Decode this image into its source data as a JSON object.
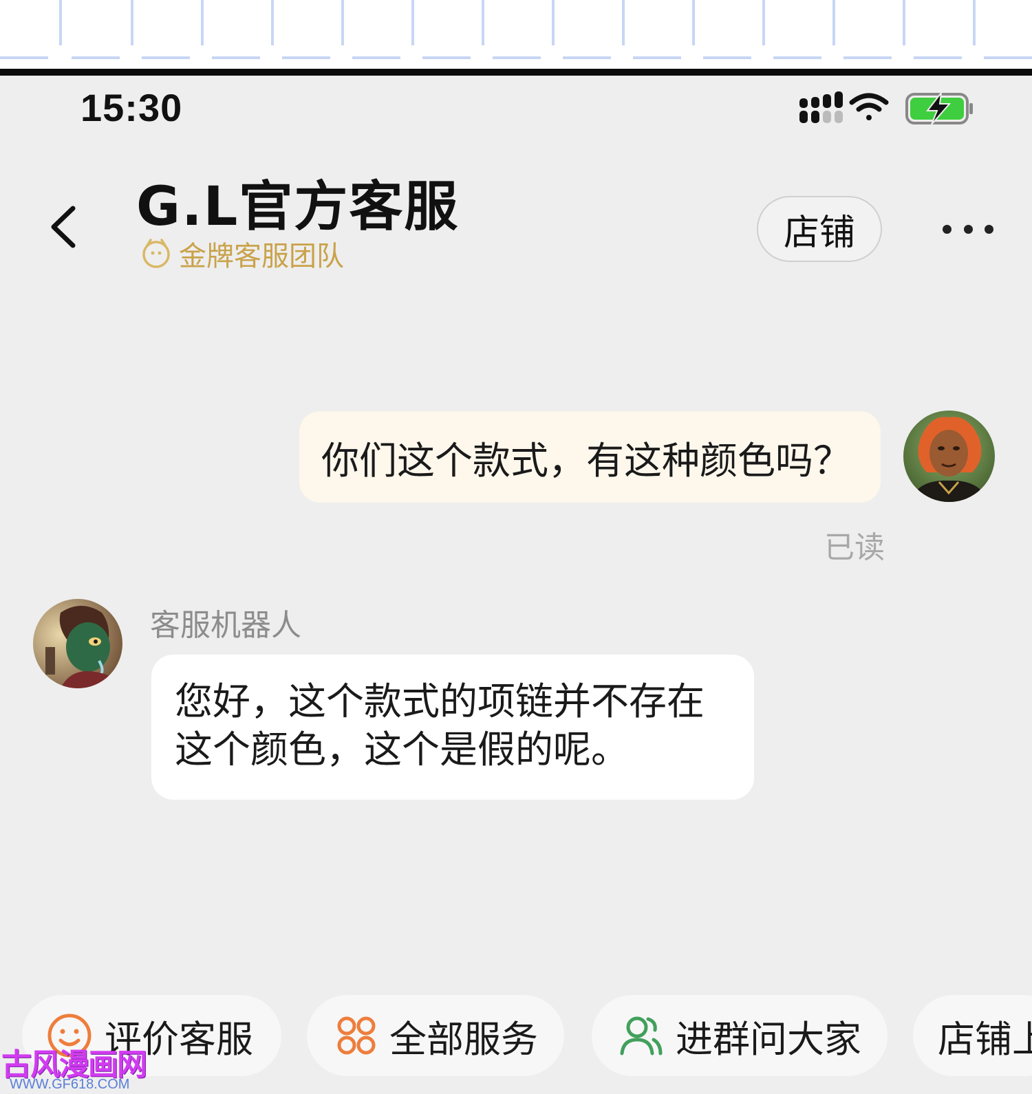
{
  "status_bar": {
    "time": "15:30",
    "icons": [
      "signal-icon",
      "wifi-icon",
      "battery-charging-icon"
    ]
  },
  "header": {
    "title": "G.L官方客服",
    "subtitle": "金牌客服团队",
    "shop_button": "店铺",
    "icons": [
      "back-icon",
      "medal-icon",
      "more-icon"
    ]
  },
  "messages": [
    {
      "direction": "outgoing",
      "text": "你们这个款式，有这种颜色吗？",
      "status": "已读"
    },
    {
      "direction": "incoming",
      "sender": "客服机器人",
      "lines": [
        "您好，这个款式的项链并不存在",
        "这个颜色，这个是假的呢。"
      ]
    }
  ],
  "quick_actions": [
    {
      "label": "评价客服",
      "icon": "smiley-icon"
    },
    {
      "label": "全部服务",
      "icon": "services-grid-icon"
    },
    {
      "label": "进群问大家",
      "icon": "group-users-icon"
    },
    {
      "label": "店铺上"
    }
  ],
  "watermark": {
    "title": "古风漫画网",
    "url": "WWW.GF618.COM"
  },
  "colors": {
    "background": "#eeeeee",
    "accent_gold": "#c9a24a",
    "outgoing_bubble": "#fdf7ec",
    "incoming_bubble": "#ffffff",
    "battery_green": "#3fce3f",
    "services_orange": "#ee7d3c",
    "group_green": "#42a05c"
  }
}
